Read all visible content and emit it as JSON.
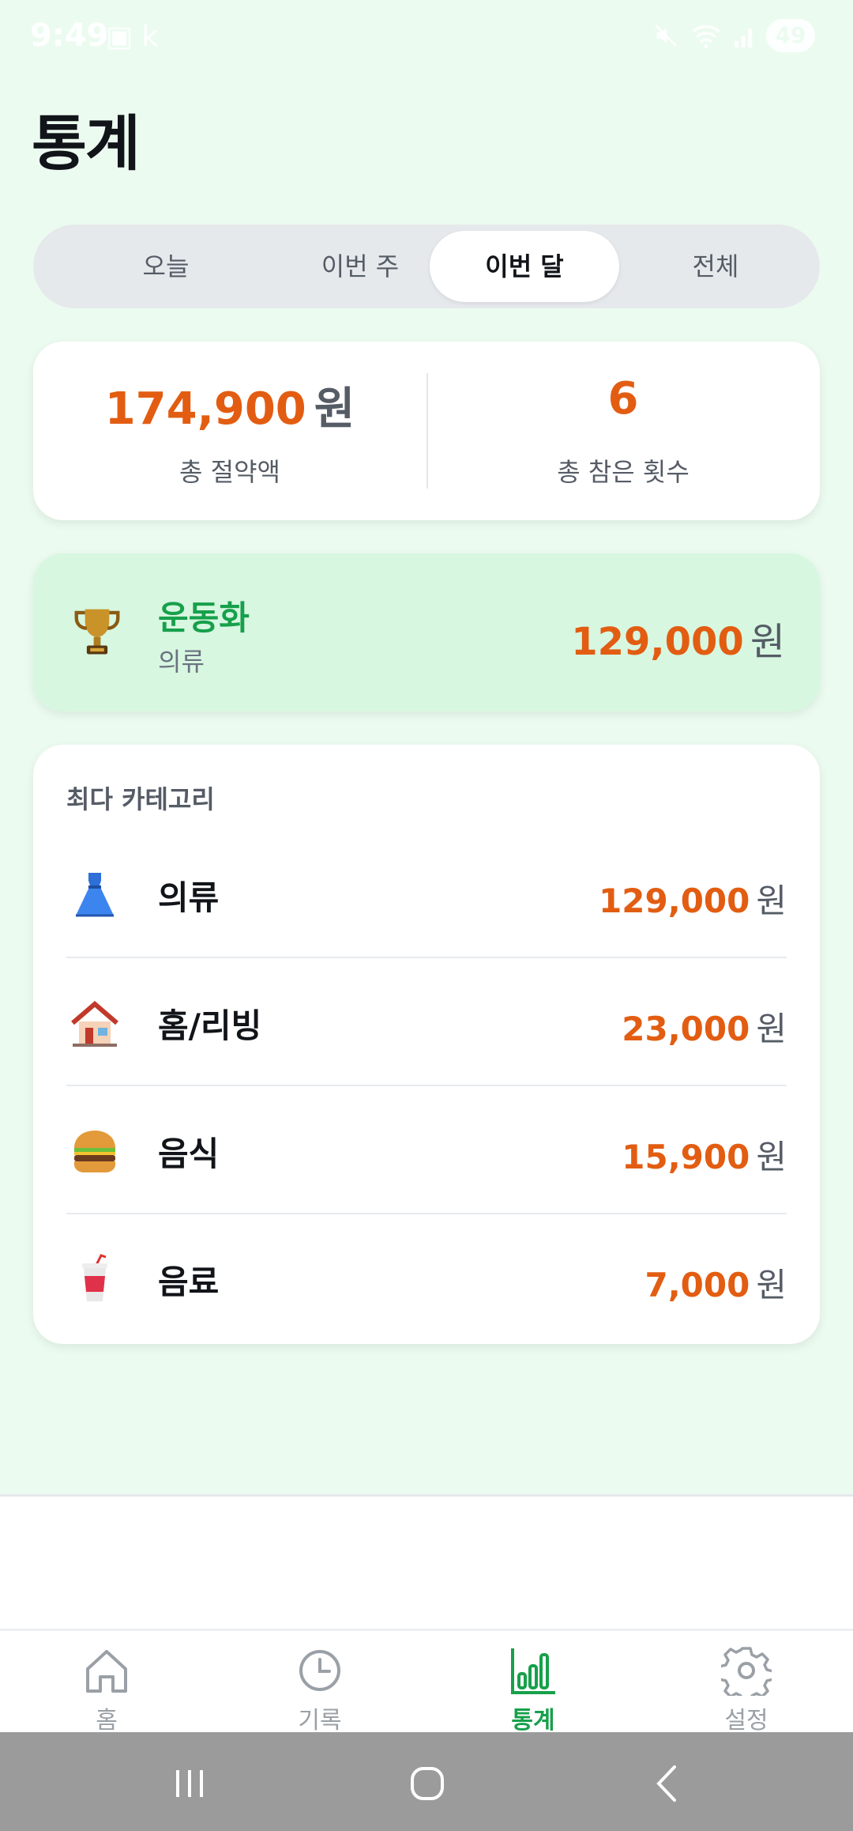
{
  "status_bar": {
    "time": "9:49",
    "left_icons": "▣ k",
    "battery": "49"
  },
  "page": {
    "title": "통계"
  },
  "tabs": [
    {
      "label": "오늘",
      "active": false
    },
    {
      "label": "이번 주",
      "active": false
    },
    {
      "label": "이번 달",
      "active": true
    },
    {
      "label": "전체",
      "active": false
    }
  ],
  "summary": {
    "total_saved_value": "174,900",
    "total_saved_unit": "원",
    "total_saved_label": "총 절약액",
    "resist_count_value": "6",
    "resist_count_label": "총 참은 횟수"
  },
  "top_item": {
    "icon": "trophy-icon",
    "name": "운동화",
    "category": "의류",
    "amount": "129,000",
    "unit": "원"
  },
  "top_categories": {
    "heading": "최다 카테고리",
    "items": [
      {
        "icon": "dress-icon",
        "name": "의류",
        "amount": "129,000",
        "unit": "원"
      },
      {
        "icon": "house-icon",
        "name": "홈/리빙",
        "amount": "23,000",
        "unit": "원"
      },
      {
        "icon": "burger-icon",
        "name": "음식",
        "amount": "15,900",
        "unit": "원"
      },
      {
        "icon": "cup-icon",
        "name": "음료",
        "amount": "7,000",
        "unit": "원"
      }
    ]
  },
  "bottom_nav": [
    {
      "icon": "home-icon",
      "label": "홈",
      "active": false
    },
    {
      "icon": "clock-icon",
      "label": "기록",
      "active": false
    },
    {
      "icon": "bar-chart-icon",
      "label": "통계",
      "active": true
    },
    {
      "icon": "gear-icon",
      "label": "설정",
      "active": false
    }
  ],
  "colors": {
    "accent_green": "#17a04b",
    "amount_orange": "#e25d12",
    "background": "#ecfbf0"
  }
}
